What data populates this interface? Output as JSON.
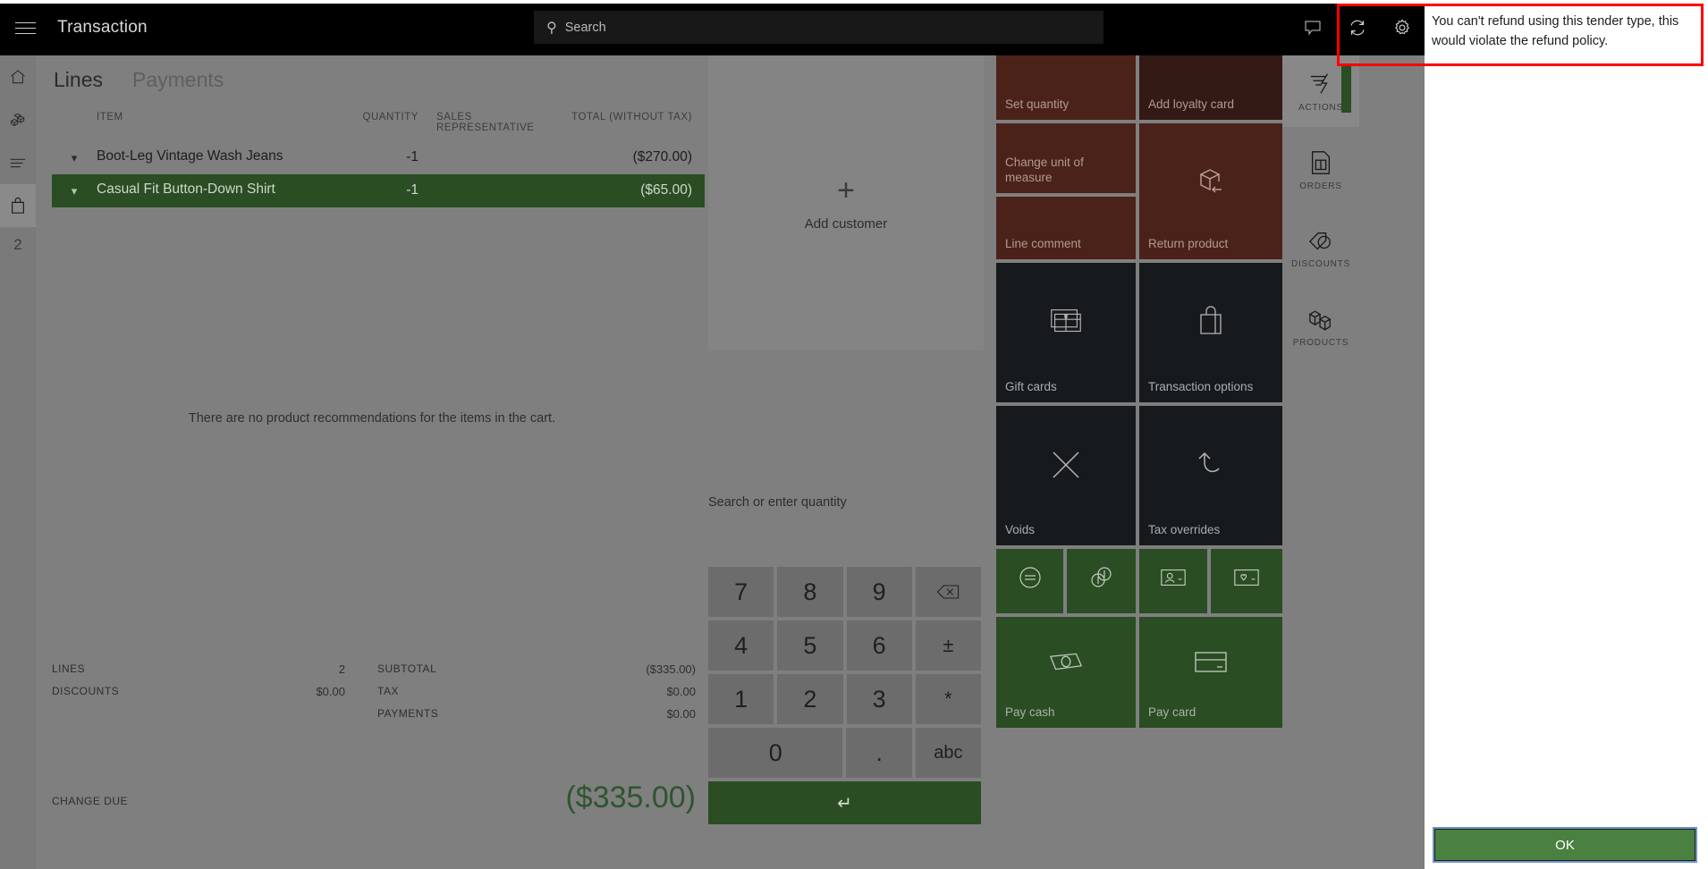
{
  "topbar": {
    "app_title": "Transaction",
    "menu_icon": "hamburger-icon",
    "search_placeholder": "Search",
    "icons": [
      "comment-icon",
      "refresh-icon",
      "gear-icon"
    ]
  },
  "left_rail": {
    "items": [
      {
        "icon": "home-icon",
        "name": "home"
      },
      {
        "icon": "products-boxes-icon",
        "name": "products"
      },
      {
        "icon": "list-lines-icon",
        "name": "list"
      },
      {
        "icon": "shopping-bag-icon",
        "name": "cart",
        "selected": true
      }
    ],
    "count": "2"
  },
  "lines_pane": {
    "tabs": [
      {
        "label": "Lines",
        "active": true
      },
      {
        "label": "Payments",
        "active": false
      }
    ],
    "columns": {
      "item": "ITEM",
      "quantity": "QUANTITY",
      "sales_rep": "SALES REPRESENTATIVE",
      "total": "TOTAL (WITHOUT TAX)"
    },
    "rows": [
      {
        "chevron": "chevron-down-icon",
        "item": "Boot-Leg Vintage Wash Jeans",
        "quantity": "-1",
        "sales_rep": "",
        "total": "($270.00)",
        "selected": false
      },
      {
        "chevron": "chevron-down-icon",
        "item": "Casual Fit Button-Down Shirt",
        "quantity": "-1",
        "sales_rep": "",
        "total": "($65.00)",
        "selected": true
      }
    ],
    "no_recommendations": "There are no product recommendations for the items in the cart.",
    "totals": {
      "lines_label": "LINES",
      "lines_value": "2",
      "discounts_label": "DISCOUNTS",
      "discounts_value": "$0.00",
      "subtotal_label": "SUBTOTAL",
      "subtotal_value": "($335.00)",
      "tax_label": "TAX",
      "tax_value": "$0.00",
      "payments_label": "PAYMENTS",
      "payments_value": "$0.00",
      "change_due_label": "CHANGE DUE",
      "change_due_value": "($335.00)"
    }
  },
  "middle_pane": {
    "add_customer_label": "Add customer",
    "add_customer_icon": "plus-icon",
    "quantity_placeholder": "Search or enter quantity",
    "keypad": {
      "keys": [
        "7",
        "8",
        "9",
        "4",
        "5",
        "6",
        "1",
        "2",
        "3",
        "0",
        "."
      ],
      "backspace_icon": "backspace-icon",
      "plus_minus": "±",
      "asterisk": "*",
      "abc": "abc",
      "enter_icon": "enter-arrow-icon"
    }
  },
  "tiles": [
    {
      "label": "Set quantity",
      "style": "brown",
      "icon": ""
    },
    {
      "label": "Add loyalty card",
      "style": "brown-d",
      "icon": ""
    },
    {
      "label": "Change unit of measure",
      "style": "brown",
      "icon": ""
    },
    {
      "label": "Return product",
      "style": "brown",
      "icon": "return-box-icon"
    },
    {
      "label": "Line comment",
      "style": "brown",
      "icon": ""
    },
    {
      "label": "Gift cards",
      "style": "dark",
      "icon": "gift-card-icon"
    },
    {
      "label": "Transaction options",
      "style": "dark",
      "icon": "shopping-bag-icon"
    },
    {
      "label": "Voids",
      "style": "dark",
      "icon": "x-icon"
    },
    {
      "label": "Tax overrides",
      "style": "dark",
      "icon": "undo-arrow-icon"
    },
    {
      "label": "",
      "style": "green",
      "icon": "equals-circle-icon"
    },
    {
      "label": "",
      "style": "green",
      "icon": "currency-coins-icon"
    },
    {
      "label": "",
      "style": "green",
      "icon": "id-card-icon"
    },
    {
      "label": "",
      "style": "green",
      "icon": "loyalty-card-icon"
    },
    {
      "label": "Pay cash",
      "style": "green",
      "icon": "cash-icon"
    },
    {
      "label": "Pay card",
      "style": "green",
      "icon": "credit-card-icon"
    }
  ],
  "right_rail": [
    {
      "label": "ACTIONS",
      "icon": "actions-lightning-icon",
      "active": true
    },
    {
      "label": "ORDERS",
      "icon": "orders-document-icon",
      "active": false
    },
    {
      "label": "DISCOUNTS",
      "icon": "discount-tag-icon",
      "active": false
    },
    {
      "label": "PRODUCTS",
      "icon": "products-cubes-icon",
      "active": false
    }
  ],
  "dialog": {
    "message": "You can't refund using this tender type, this would violate the refund policy.",
    "ok_label": "OK"
  },
  "colors": {
    "accent_green": "#2a4d23",
    "ok_button_green": "#4a8040",
    "tile_brown": "#4b2219",
    "tile_dark": "#171a1d",
    "highlight_red": "#ff0000",
    "topbar_black": "#000000",
    "dim_overlay": "#7f7f7f"
  }
}
